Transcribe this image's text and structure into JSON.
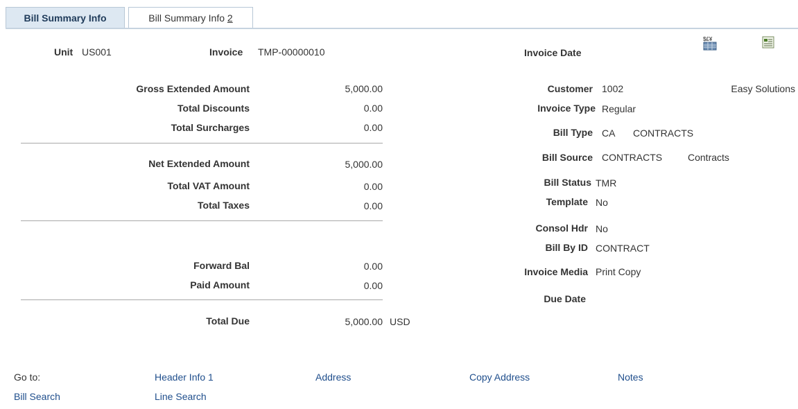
{
  "tabs": [
    {
      "label": "Bill Summary Info",
      "active": true
    },
    {
      "label_prefix": "Bill Summary Info ",
      "label_suffix": "2",
      "active": false
    }
  ],
  "header": {
    "unit_label": "Unit",
    "unit_value": "US001",
    "invoice_label": "Invoice",
    "invoice_value": "TMP-00000010",
    "invoice_date_label": "Invoice Date",
    "icons": [
      "currency-icon",
      "spreadsheet-icon"
    ]
  },
  "amounts": {
    "gross_extended_label": "Gross Extended Amount",
    "gross_extended": "5,000.00",
    "total_discounts_label": "Total Discounts",
    "total_discounts": "0.00",
    "total_surcharges_label": "Total Surcharges",
    "total_surcharges": "0.00",
    "net_extended_label": "Net Extended Amount",
    "net_extended": "5,000.00",
    "total_vat_label": "Total VAT Amount",
    "total_vat": "0.00",
    "total_taxes_label": "Total Taxes",
    "total_taxes": "0.00",
    "forward_bal_label": "Forward Bal",
    "forward_bal": "0.00",
    "paid_amount_label": "Paid Amount",
    "paid_amount": "0.00",
    "total_due_label": "Total Due",
    "total_due": "5,000.00",
    "currency": "USD"
  },
  "details": {
    "customer_label": "Customer",
    "customer_id": "1002",
    "customer_name": "Easy Solutions",
    "invoice_type_label": "Invoice Type",
    "invoice_type": "Regular",
    "bill_type_label": "Bill Type",
    "bill_type_code": "CA",
    "bill_type_desc": "CONTRACTS",
    "bill_source_label": "Bill Source",
    "bill_source_code": "CONTRACTS",
    "bill_source_desc": "Contracts",
    "bill_status_label": "Bill Status",
    "bill_status": "TMR",
    "template_label": "Template",
    "template": "No",
    "consol_hdr_label": "Consol Hdr",
    "consol_hdr": "No",
    "bill_by_id_label": "Bill By ID",
    "bill_by_id": "CONTRACT",
    "invoice_media_label": "Invoice Media",
    "invoice_media": "Print Copy",
    "due_date_label": "Due Date"
  },
  "goto": {
    "label": "Go to:",
    "links": [
      "Header Info 1",
      "Address",
      "Copy Address",
      "Notes",
      "Bill Search",
      "Line Search"
    ]
  },
  "colors": {
    "link": "#1f4e8c",
    "tab_active_bg": "#dde8f2",
    "rule": "#a8a8a8"
  }
}
